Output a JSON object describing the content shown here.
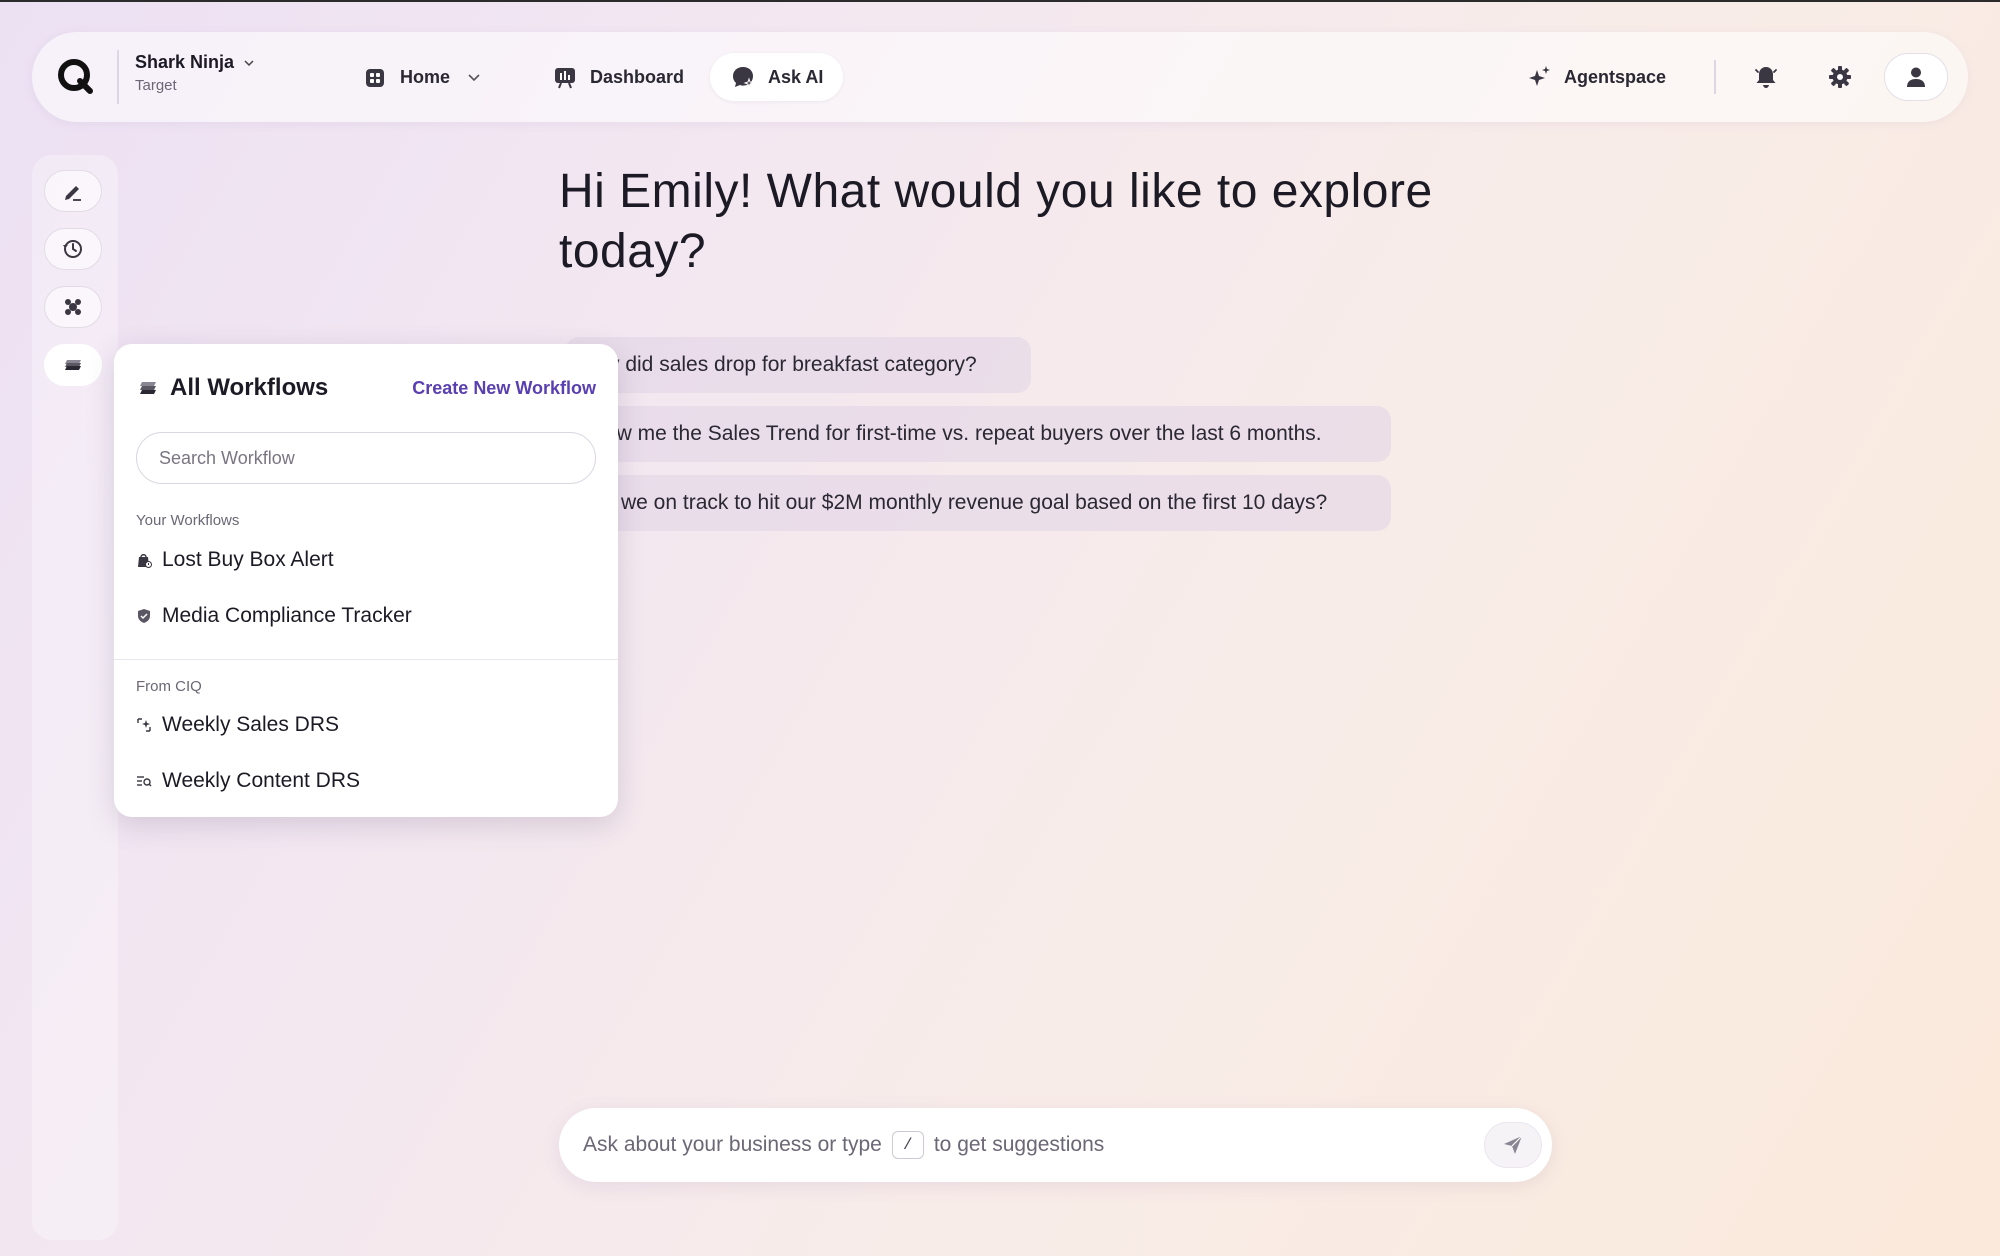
{
  "header": {
    "brand_name": "Shark Ninja",
    "brand_sub": "Target",
    "nav": [
      {
        "label": "Home",
        "icon": "home-icon"
      },
      {
        "label": "Dashboard",
        "icon": "dashboard-icon"
      },
      {
        "label": "Ask AI",
        "icon": "ask-ai-icon",
        "active": true
      }
    ],
    "agentspace_label": "Agentspace",
    "icons": [
      "bell-icon",
      "gear-icon",
      "user-icon"
    ]
  },
  "sidebar": {
    "buttons": [
      {
        "icon": "edit-icon"
      },
      {
        "icon": "history-icon"
      },
      {
        "icon": "agents-icon"
      },
      {
        "icon": "workflows-icon",
        "active": true
      }
    ]
  },
  "main": {
    "greeting": "Hi Emily! What would you like to explore today?",
    "suggestions": [
      "y did sales drop for breakfast category?",
      "ow me the Sales Trend for first-time vs. repeat buyers over the last 6 months.",
      "we on track to hit our $2M monthly revenue goal based on the first 10 days?"
    ]
  },
  "workflows_popup": {
    "title": "All Workflows",
    "create_label": "Create New Workflow",
    "search_placeholder": "Search Workflow",
    "your_label": "Your Workflows",
    "your_items": [
      "Lost Buy Box Alert",
      "Media Compliance Tracker"
    ],
    "ciq_label": "From CIQ",
    "ciq_items": [
      "Weekly Sales DRS",
      "Weekly Content DRS"
    ]
  },
  "chat": {
    "prefix": "Ask about your business or type",
    "key": "/",
    "suffix": "to get suggestions"
  },
  "colors": {
    "accent": "#5a3fb0",
    "background_start": "#ece1f3",
    "background_end": "#fbeadb"
  }
}
